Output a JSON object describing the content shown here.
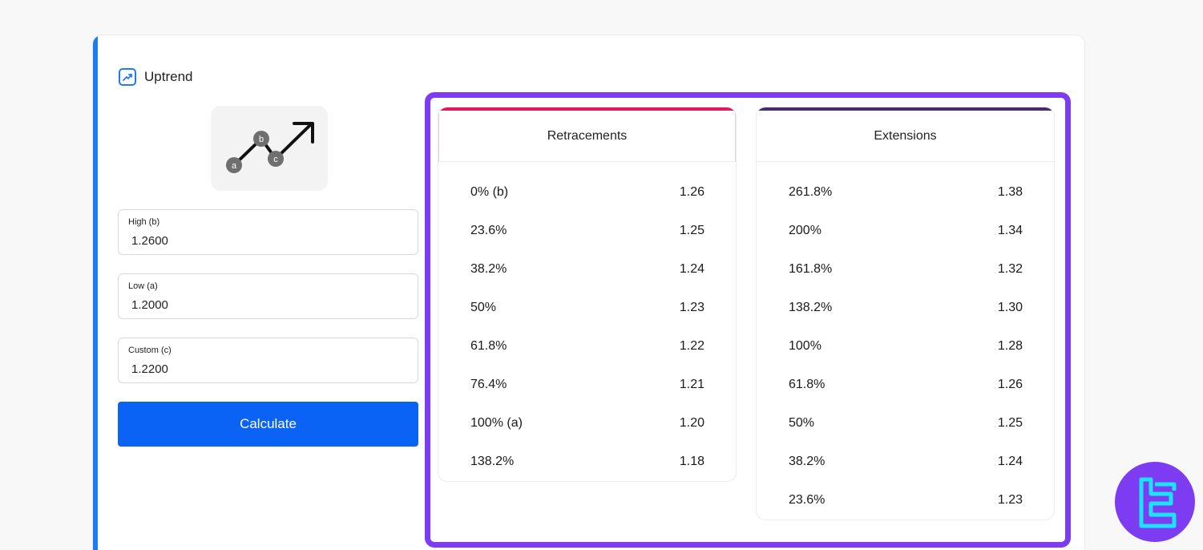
{
  "colors": {
    "accent_blue": "#1f7bf2",
    "button_blue": "#0a63f5",
    "results_border": "#7d3cf1",
    "retracements_bar": "#e2185e",
    "extensions_bar": "#4a2a6b",
    "logo_cyan": "#19e3ff"
  },
  "mode": {
    "label": "Uptrend",
    "icon": "trend-up-icon"
  },
  "illustration": {
    "points": [
      "a",
      "b",
      "c"
    ],
    "icon": "uptrend-abc-illustration"
  },
  "fields": [
    {
      "label": "High (b)",
      "value": "1.2600"
    },
    {
      "label": "Low (a)",
      "value": "1.2000"
    },
    {
      "label": "Custom (c)",
      "value": "1.2200"
    }
  ],
  "calculate_label": "Calculate",
  "retracements": {
    "title": "Retracements",
    "rows": [
      {
        "level": "0% (b)",
        "value": "1.26"
      },
      {
        "level": "23.6%",
        "value": "1.25"
      },
      {
        "level": "38.2%",
        "value": "1.24"
      },
      {
        "level": "50%",
        "value": "1.23"
      },
      {
        "level": "61.8%",
        "value": "1.22"
      },
      {
        "level": "76.4%",
        "value": "1.21"
      },
      {
        "level": "100% (a)",
        "value": "1.20"
      },
      {
        "level": "138.2%",
        "value": "1.18"
      }
    ]
  },
  "extensions": {
    "title": "Extensions",
    "rows": [
      {
        "level": "261.8%",
        "value": "1.38"
      },
      {
        "level": "200%",
        "value": "1.34"
      },
      {
        "level": "161.8%",
        "value": "1.32"
      },
      {
        "level": "138.2%",
        "value": "1.30"
      },
      {
        "level": "100%",
        "value": "1.28"
      },
      {
        "level": "61.8%",
        "value": "1.26"
      },
      {
        "level": "50%",
        "value": "1.25"
      },
      {
        "level": "38.2%",
        "value": "1.24"
      },
      {
        "level": "23.6%",
        "value": "1.23"
      }
    ]
  },
  "badge": {
    "icon": "brand-logo-icon"
  }
}
